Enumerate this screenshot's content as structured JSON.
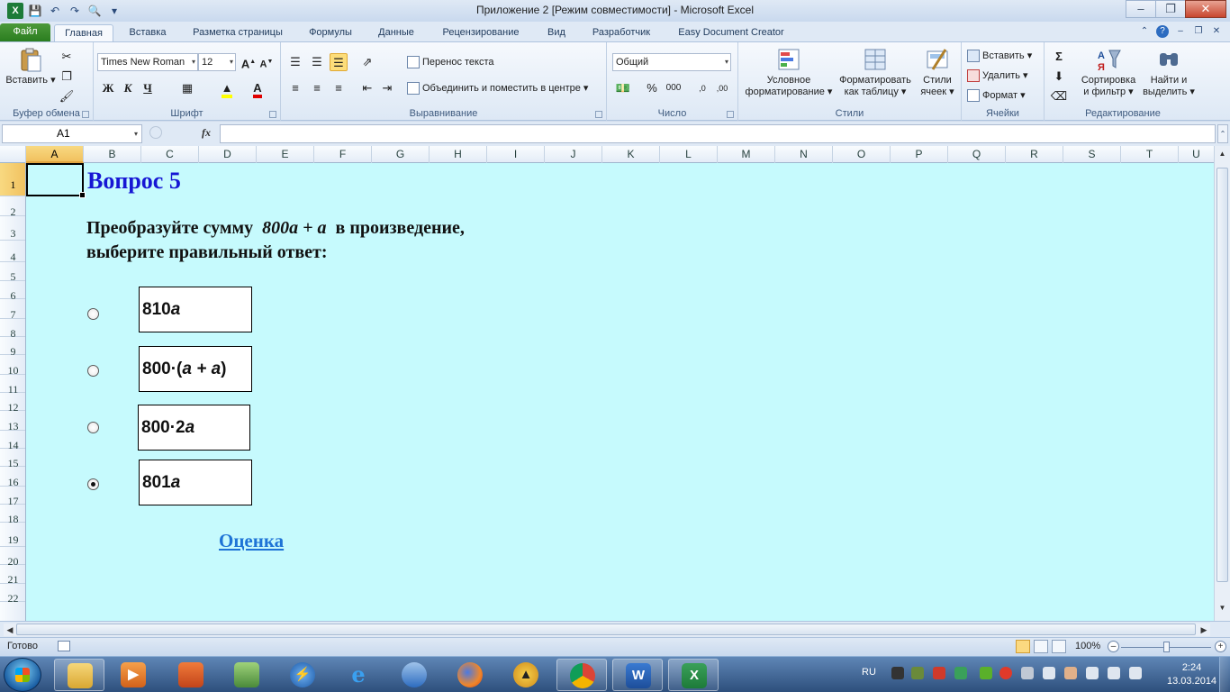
{
  "window": {
    "title": "Приложение 2  [Режим совместимости]  -  Microsoft Excel"
  },
  "ribbon": {
    "tabs": [
      "Файл",
      "Главная",
      "Вставка",
      "Разметка страницы",
      "Формулы",
      "Данные",
      "Рецензирование",
      "Вид",
      "Разработчик",
      "Easy Document Creator"
    ],
    "active_tab": "Главная",
    "clipboard": {
      "paste": "Вставить",
      "label": "Буфер обмена"
    },
    "font": {
      "family": "Times New Roman",
      "size": "12",
      "bold": "Ж",
      "italic": "К",
      "underline": "Ч",
      "label": "Шрифт"
    },
    "alignment": {
      "wrap": "Перенос текста",
      "merge": "Объединить и поместить в центре",
      "label": "Выравнивание"
    },
    "number": {
      "format": "Общий",
      "percent": "%",
      "thousands": "000",
      "label": "Число"
    },
    "styles": {
      "conditional_1": "Условное",
      "conditional_2": "форматирование",
      "table_1": "Форматировать",
      "table_2": "как таблицу",
      "cell_1": "Стили",
      "cell_2": "ячеек",
      "label": "Стили"
    },
    "cells": {
      "insert": "Вставить",
      "delete": "Удалить",
      "format": "Формат",
      "label": "Ячейки"
    },
    "editing": {
      "sum": "Σ",
      "sort_1": "Сортировка",
      "sort_2": "и фильтр",
      "find_1": "Найти и",
      "find_2": "выделить",
      "label": "Редактирование"
    }
  },
  "formula_bar": {
    "name_box": "A1",
    "fx": "fx",
    "formula": ""
  },
  "sheet": {
    "columns": [
      "A",
      "B",
      "C",
      "D",
      "E",
      "F",
      "G",
      "H",
      "I",
      "J",
      "K",
      "L",
      "M",
      "N",
      "O",
      "P",
      "Q",
      "R",
      "S",
      "T",
      "U"
    ],
    "rows": [
      "1",
      "2",
      "3",
      "4",
      "5",
      "6",
      "7",
      "8",
      "9",
      "10",
      "11",
      "12",
      "13",
      "14",
      "15",
      "16",
      "17",
      "18",
      "19",
      "20",
      "21",
      "22"
    ],
    "selected_cell": "A1",
    "background_color": "#C6FAFD"
  },
  "content": {
    "title": "Вопрос 5",
    "task_line1_a": "Преобразуйте сумму  ",
    "task_line1_expr": "800a + a",
    "task_line1_b": "  в произведение,",
    "task_line2": "выберите правильный ответ:",
    "answers": [
      {
        "num": "810",
        "var": "a",
        "rest": "",
        "selected": false
      },
      {
        "num": "800·(",
        "var": "a + a",
        "rest": ")",
        "selected": false
      },
      {
        "num": "800·2",
        "var": "a",
        "rest": "",
        "selected": false
      },
      {
        "num": "801",
        "var": "a",
        "rest": "",
        "selected": true
      }
    ],
    "link": "Оценка"
  },
  "status_bar": {
    "ready": "Готово",
    "zoom": "100%"
  },
  "taskbar": {
    "language": "RU",
    "time": "2:24",
    "date": "13.03.2014"
  }
}
